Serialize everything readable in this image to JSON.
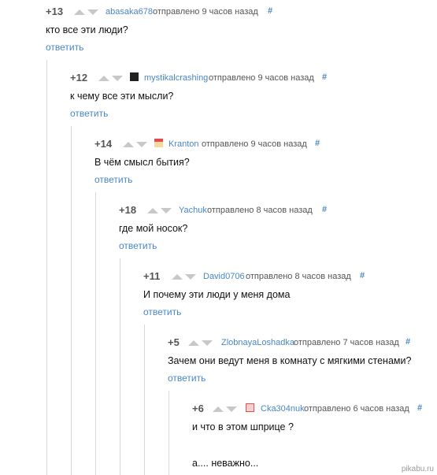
{
  "comments": [
    {
      "rating": "+13",
      "user": "abasaka678",
      "meta": "отправлено 9 часов назад",
      "hash": "#",
      "text": "кто все эти люди?",
      "reply": "ответить",
      "avatar": ""
    },
    {
      "rating": "+12",
      "user": "mystikalcrashing",
      "meta": "отправлено 9 часов назад",
      "hash": "#",
      "text": "к чему все эти мысли?",
      "reply": "ответить",
      "avatar": "dark-avatar-icon"
    },
    {
      "rating": "+14",
      "user": "Kranton",
      "meta": "отправлено 9 часов назад",
      "hash": "#",
      "text": "В чём смысл бытия?",
      "reply": "ответить",
      "avatar": "popcorn-avatar-icon"
    },
    {
      "rating": "+18",
      "user": "Yachuk",
      "meta": "отправлено 8 часов назад",
      "hash": "#",
      "text": "где мой носок?",
      "reply": "ответить",
      "avatar": ""
    },
    {
      "rating": "+11",
      "user": "David0706",
      "meta": "отправлено 8 часов назад",
      "hash": "#",
      "text": "И почему эти люди у меня дома",
      "reply": "ответить",
      "avatar": ""
    },
    {
      "rating": "+5",
      "user": "ZlobnayaLoshadka",
      "meta": "отправлено 7 часов назад",
      "hash": "#",
      "text": "Зачем они ведут меня в комнату с мягкими стенами?",
      "reply": "ответить",
      "avatar": ""
    },
    {
      "rating": "+6",
      "user": "Cka304nuk",
      "meta": "отправлено 6 часов назад",
      "hash": "#",
      "text": "и что в этом шприце ?",
      "reply": "",
      "avatar": "red-square-avatar-icon"
    }
  ],
  "last_extra_text": "а.... неважно...",
  "watermark": "pikabu.ru",
  "colors": {
    "link": "#4a86c5",
    "rating": "#555555",
    "vote": "#c8c8c8",
    "thread": "#d8d8d8"
  }
}
